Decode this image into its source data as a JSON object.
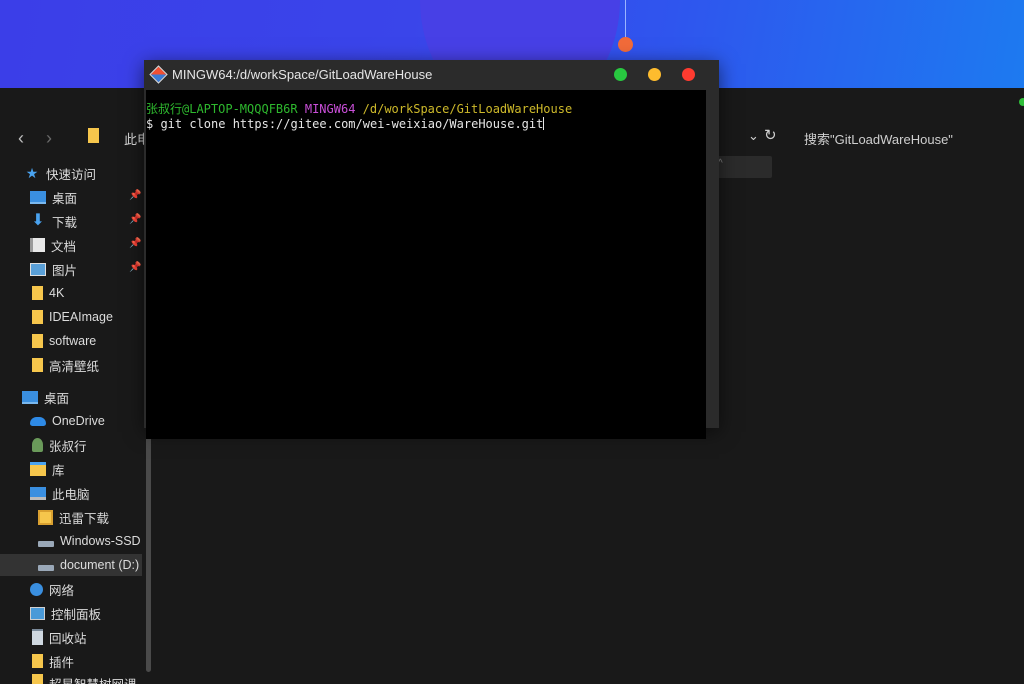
{
  "explorer": {
    "address_partial": "此电",
    "search_placeholder": "搜索\"GitLoadWareHouse\"",
    "column_header_partial": "^",
    "sidebar": {
      "quick_access": {
        "label": "快速访问",
        "icon": "star-icon"
      },
      "items": [
        {
          "label": "桌面",
          "icon": "desktop-icon",
          "pinned": true
        },
        {
          "label": "下载",
          "icon": "download-icon",
          "pinned": true
        },
        {
          "label": "文档",
          "icon": "document-icon",
          "pinned": true
        },
        {
          "label": "图片",
          "icon": "picture-icon",
          "pinned": true
        },
        {
          "label": "4K",
          "icon": "folder-icon"
        },
        {
          "label": "IDEAImage",
          "icon": "folder-icon"
        },
        {
          "label": "software",
          "icon": "folder-icon"
        },
        {
          "label": "高清壁纸",
          "icon": "folder-icon"
        }
      ],
      "desktop_root": {
        "label": "桌面",
        "icon": "desktop-icon"
      },
      "tree": [
        {
          "label": "OneDrive",
          "icon": "onedrive-icon"
        },
        {
          "label": "张叔行",
          "icon": "user-icon"
        },
        {
          "label": "库",
          "icon": "library-icon"
        },
        {
          "label": "此电脑",
          "icon": "computer-icon"
        },
        {
          "label": "迅雷下载",
          "icon": "xunlei-icon"
        },
        {
          "label": "Windows-SSD",
          "icon": "drive-icon"
        },
        {
          "label": "document (D:)",
          "icon": "drive-icon",
          "selected": true
        },
        {
          "label": "网络",
          "icon": "network-icon"
        },
        {
          "label": "控制面板",
          "icon": "control-panel-icon"
        },
        {
          "label": "回收站",
          "icon": "recycle-bin-icon"
        },
        {
          "label": "插件",
          "icon": "folder-icon"
        },
        {
          "label": "超星智慧树网课",
          "icon": "folder-icon"
        }
      ]
    }
  },
  "terminal": {
    "title": "MINGW64:/d/workSpace/GitLoadWareHouse",
    "prompt_user": "张叔行@LAPTOP-MQQQFB6R",
    "prompt_env": "MINGW64",
    "prompt_path": "/d/workSpace/GitLoadWareHouse",
    "command_line": "$ git clone https://gitee.com/wei-weixiao/WareHouse.git",
    "colors": {
      "user": "#2eb82e",
      "env": "#c94fd8",
      "path": "#cdb92a"
    }
  }
}
